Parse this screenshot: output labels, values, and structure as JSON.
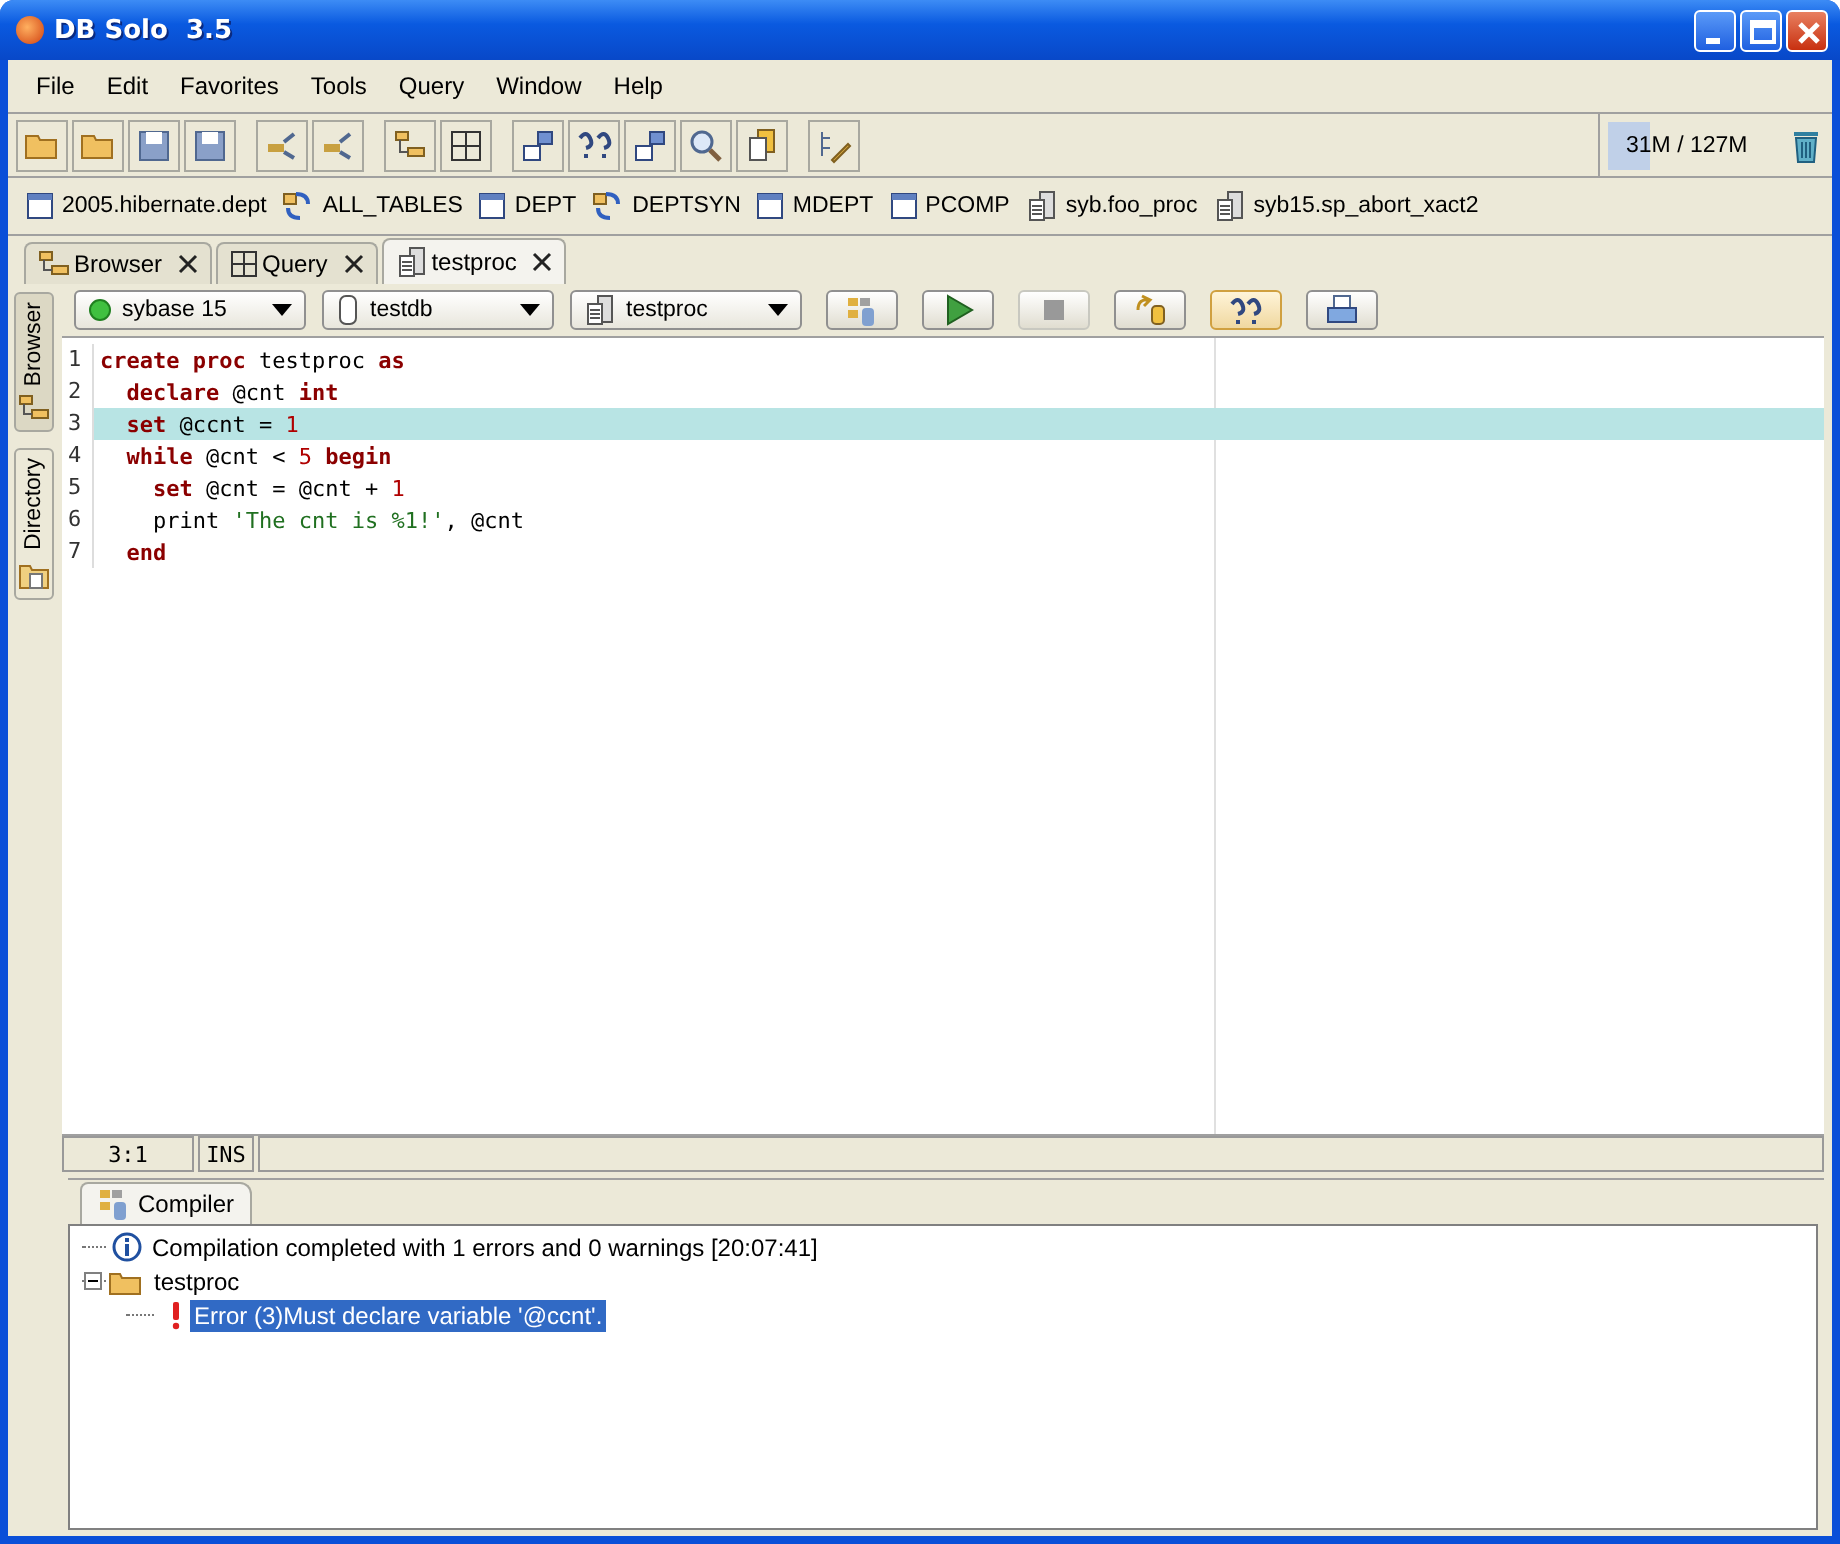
{
  "window": {
    "title": "DB Solo  3.5"
  },
  "menu": [
    "File",
    "Edit",
    "Favorites",
    "Tools",
    "Query",
    "Window",
    "Help"
  ],
  "memory": {
    "reading": "31M / 127M",
    "level": 0.24
  },
  "favorites": [
    {
      "label": "2005.hibernate.dept",
      "kind": "table"
    },
    {
      "label": "ALL_TABLES",
      "kind": "synonym"
    },
    {
      "label": "DEPT",
      "kind": "table"
    },
    {
      "label": "DEPTSYN",
      "kind": "synonym"
    },
    {
      "label": "MDEPT",
      "kind": "table"
    },
    {
      "label": "PCOMP",
      "kind": "table"
    },
    {
      "label": "syb.foo_proc",
      "kind": "proc"
    },
    {
      "label": "syb15.sp_abort_xact2",
      "kind": "proc"
    }
  ],
  "tabs": [
    {
      "label": "Browser",
      "kind": "browser",
      "selected": false
    },
    {
      "label": "Query",
      "kind": "query",
      "selected": false
    },
    {
      "label": "testproc",
      "kind": "proc",
      "selected": true
    }
  ],
  "side_tabs": [
    {
      "label": "Browser",
      "selected": true
    },
    {
      "label": "Directory",
      "selected": false
    }
  ],
  "selectors": [
    {
      "value": "sybase 15",
      "kind": "connection"
    },
    {
      "value": "testdb",
      "kind": "database"
    },
    {
      "value": "testproc",
      "kind": "proc"
    }
  ],
  "code": [
    {
      "number": "1",
      "highlighted": false,
      "tokens": [
        {
          "keyword": "create proc"
        },
        {
          "plain": " testproc "
        },
        {
          "keyword": "as"
        }
      ]
    },
    {
      "number": "2",
      "highlighted": false,
      "tokens": [
        {
          "keyword": "  declare"
        },
        {
          "plain": " @cnt "
        },
        {
          "keyword": "int"
        }
      ]
    },
    {
      "number": "3",
      "highlighted": true,
      "tokens": [
        {
          "keyword": "  set"
        },
        {
          "plain": " @ccnt = "
        },
        {
          "number": "1"
        }
      ]
    },
    {
      "number": "4",
      "highlighted": false,
      "tokens": [
        {
          "keyword": "  while"
        },
        {
          "plain": " @cnt < "
        },
        {
          "number": "5"
        },
        {
          "keyword": " begin"
        }
      ]
    },
    {
      "number": "5",
      "highlighted": false,
      "tokens": [
        {
          "keyword": "    set"
        },
        {
          "plain": " @cnt = @cnt + "
        },
        {
          "number": "1"
        }
      ]
    },
    {
      "number": "6",
      "highlighted": false,
      "tokens": [
        {
          "plain": "    print "
        },
        {
          "string": "'The cnt is %1!'"
        },
        {
          "plain": ", @cnt"
        }
      ]
    },
    {
      "number": "7",
      "highlighted": false,
      "tokens": [
        {
          "keyword": "  end"
        }
      ]
    }
  ],
  "status": {
    "position": "3:1",
    "mode": "INS"
  },
  "output": {
    "tab": "Compiler",
    "tree": [
      {
        "label": "Compilation completed with 1 errors and 0 warnings [20:07:41]",
        "kind": "info",
        "selected": false
      },
      {
        "label": "testproc",
        "kind": "folder",
        "selected": false,
        "expanded": true,
        "children": [
          {
            "label": "Error (3)Must declare variable '@ccnt'.",
            "kind": "error",
            "selected": true
          }
        ]
      }
    ]
  }
}
